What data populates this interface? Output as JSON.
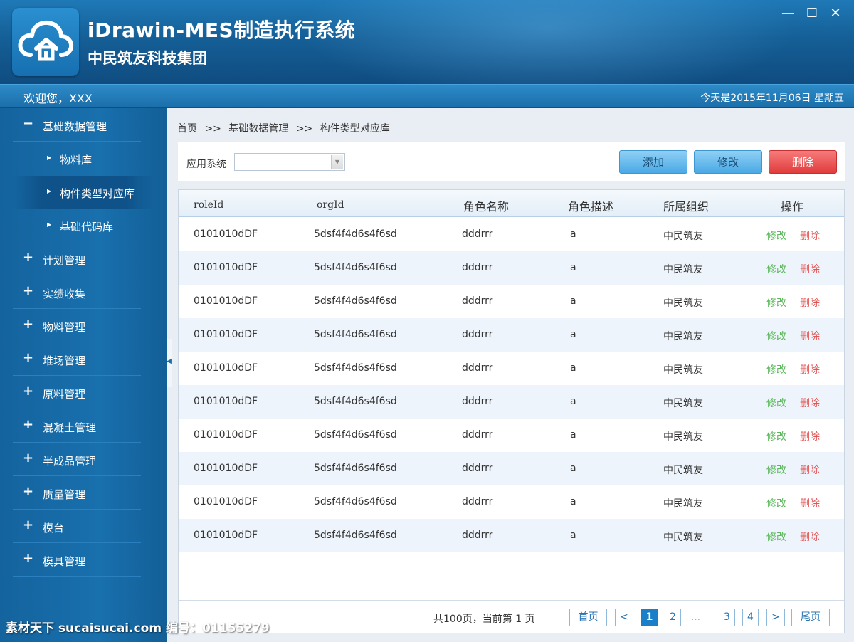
{
  "header": {
    "title": "iDrawin-MES制造执行系统",
    "subtitle": "中民筑友科技集团",
    "window_controls": [
      "—",
      "☐",
      "✕"
    ]
  },
  "welcome_bar": {
    "welcome": "欢迎您，XXX",
    "date": "今天是2015年11月06日 星期五"
  },
  "sidebar": {
    "items": [
      {
        "sign": "−",
        "label": "基础数据管理"
      },
      {
        "label": "物料库",
        "sub": true
      },
      {
        "label": "构件类型对应库",
        "sub": true,
        "active": true
      },
      {
        "label": "基础代码库",
        "sub": true
      },
      {
        "sign": "+",
        "label": "计划管理"
      },
      {
        "sign": "+",
        "label": "实绩收集"
      },
      {
        "sign": "+",
        "label": "物料管理"
      },
      {
        "sign": "+",
        "label": "堆场管理"
      },
      {
        "sign": "+",
        "label": "原料管理"
      },
      {
        "sign": "+",
        "label": "混凝土管理"
      },
      {
        "sign": "+",
        "label": "半成品管理"
      },
      {
        "sign": "+",
        "label": "质量管理"
      },
      {
        "sign": "+",
        "label": "模台"
      },
      {
        "sign": "+",
        "label": "模具管理"
      }
    ]
  },
  "breadcrumb": [
    "首页",
    ">>",
    "基础数据管理",
    ">>",
    "构件类型对应库"
  ],
  "toolbar": {
    "system_label": "应用系统",
    "system_value": "",
    "add_label": "添加",
    "edit_label": "修改",
    "delete_label": "删除"
  },
  "table": {
    "columns": [
      "roleId",
      "orgId",
      "角色名称",
      "角色描述",
      "所属组织",
      "操作"
    ],
    "rows": [
      {
        "roleId": "0101010dDF",
        "orgId": "5dsf4f4d6s4f6sd",
        "name": "dddrrr",
        "desc": "a",
        "org": "中民筑友",
        "edit": "修改",
        "del": "删除"
      },
      {
        "roleId": "0101010dDF",
        "orgId": "5dsf4f4d6s4f6sd",
        "name": "dddrrr",
        "desc": "a",
        "org": "中民筑友",
        "edit": "修改",
        "del": "删除"
      },
      {
        "roleId": "0101010dDF",
        "orgId": "5dsf4f4d6s4f6sd",
        "name": "dddrrr",
        "desc": "a",
        "org": "中民筑友",
        "edit": "修改",
        "del": "删除"
      },
      {
        "roleId": "0101010dDF",
        "orgId": "5dsf4f4d6s4f6sd",
        "name": "dddrrr",
        "desc": "a",
        "org": "中民筑友",
        "edit": "修改",
        "del": "删除"
      },
      {
        "roleId": "0101010dDF",
        "orgId": "5dsf4f4d6s4f6sd",
        "name": "dddrrr",
        "desc": "a",
        "org": "中民筑友",
        "edit": "修改",
        "del": "删除"
      },
      {
        "roleId": "0101010dDF",
        "orgId": "5dsf4f4d6s4f6sd",
        "name": "dddrrr",
        "desc": "a",
        "org": "中民筑友",
        "edit": "修改",
        "del": "删除"
      },
      {
        "roleId": "0101010dDF",
        "orgId": "5dsf4f4d6s4f6sd",
        "name": "dddrrr",
        "desc": "a",
        "org": "中民筑友",
        "edit": "修改",
        "del": "删除"
      },
      {
        "roleId": "0101010dDF",
        "orgId": "5dsf4f4d6s4f6sd",
        "name": "dddrrr",
        "desc": "a",
        "org": "中民筑友",
        "edit": "修改",
        "del": "删除"
      },
      {
        "roleId": "0101010dDF",
        "orgId": "5dsf4f4d6s4f6sd",
        "name": "dddrrr",
        "desc": "a",
        "org": "中民筑友",
        "edit": "修改",
        "del": "删除"
      },
      {
        "roleId": "0101010dDF",
        "orgId": "5dsf4f4d6s4f6sd",
        "name": "dddrrr",
        "desc": "a",
        "org": "中民筑友",
        "edit": "修改",
        "del": "删除"
      }
    ]
  },
  "pager": {
    "info": "共100页，当前第  1  页",
    "first": "首页",
    "prev": "<",
    "pages": [
      "1",
      "2",
      "…",
      "3",
      "4"
    ],
    "current": "1",
    "next": ">",
    "last": "尾页"
  },
  "watermark": "素材天下 sucaisucai.com   编号：01155279",
  "colors": {
    "header_bg": "#155f97",
    "sidebar_bg": "#1870ad",
    "edit_link": "#5cb85c",
    "delete_link": "#e05555",
    "delete_button": "#e13c3c",
    "page_current": "#1a7fc8"
  }
}
